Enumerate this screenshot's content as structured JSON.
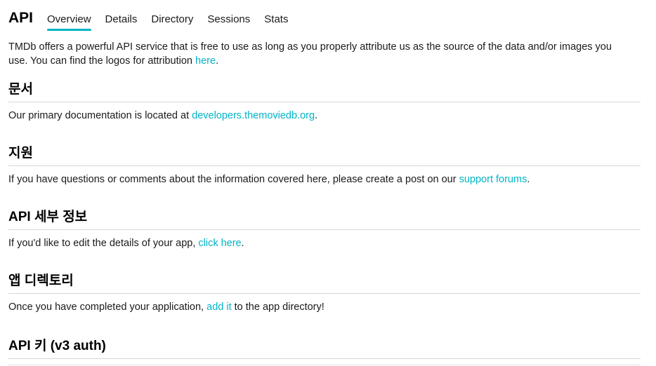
{
  "header": {
    "title": "API",
    "tabs": [
      {
        "label": "Overview",
        "active": true
      },
      {
        "label": "Details",
        "active": false
      },
      {
        "label": "Directory",
        "active": false
      },
      {
        "label": "Sessions",
        "active": false
      },
      {
        "label": "Stats",
        "active": false
      }
    ]
  },
  "intro": {
    "text": "TMDb offers a powerful API service that is free to use as long as you properly attribute us as the source of the data and/or images you use. You can find the logos for attribution ",
    "link": "here",
    "after": "."
  },
  "sections": {
    "docs": {
      "heading": "문서",
      "before": "Our primary documentation is located at ",
      "link": "developers.themoviedb.org",
      "after": "."
    },
    "support": {
      "heading": "지원",
      "before": "If you have questions or comments about the information covered here, please create a post on our ",
      "link": "support forums",
      "after": "."
    },
    "api_details": {
      "heading": "API 세부 정보",
      "before": "If you'd like to edit the details of your app, ",
      "link": "click here",
      "after": "."
    },
    "app_directory": {
      "heading": "앱 디렉토리",
      "before": "Once you have completed your application, ",
      "link": "add it",
      "after": " to the app directory!"
    },
    "api_key": {
      "heading": "API 키 (v3 auth)"
    }
  },
  "colors": {
    "accent": "#01b4c8",
    "rule": "#d7d7d7"
  }
}
